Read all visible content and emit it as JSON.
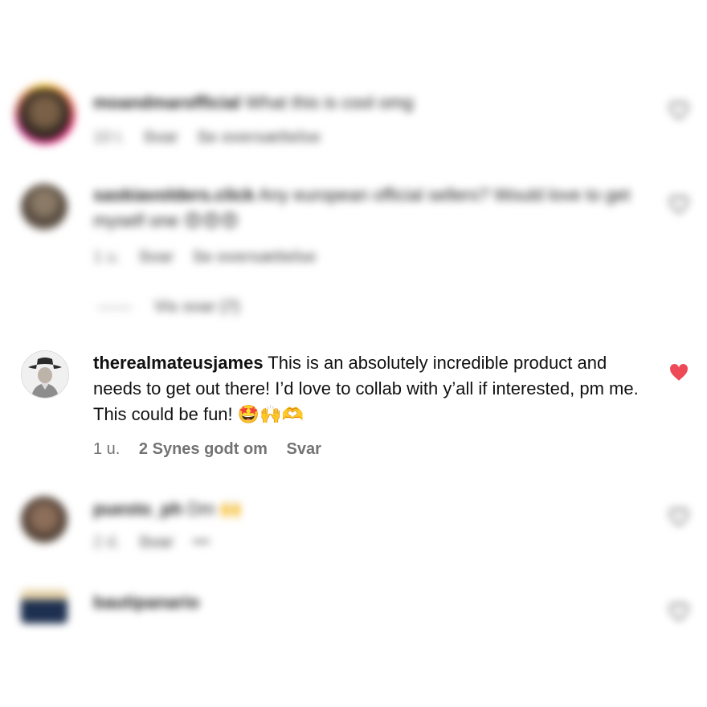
{
  "comments": [
    {
      "username": "moandmarofficial",
      "text": "What this is cool omg",
      "time": "10 t.",
      "reply": "Svar",
      "translate": "Se oversættelse",
      "liked": false
    },
    {
      "username": "saskiavolders.click",
      "text": "Any european official sellers? Would love to get myself one",
      "emoji": "😍😍😍",
      "time": "1 u.",
      "reply": "Svar",
      "translate": "Se oversættelse",
      "view_replies": "Vis svar (7)",
      "liked": false
    },
    {
      "username": "therealmateusjames",
      "text": "This is an absolutely incredible product and needs to get out there! I’d love to collab with y’all if interested, pm me. This could be fun!",
      "emoji": "🤩🙌🫶",
      "time": "1 u.",
      "likes": "2 Synes godt om",
      "reply": "Svar",
      "liked": true
    },
    {
      "username": "puesto_ph",
      "text": "Dm",
      "emoji": "🙌",
      "time": "2 d.",
      "reply": "Svar",
      "more": "•••",
      "liked": false
    },
    {
      "username": "bautipanario",
      "text": "",
      "liked": false
    }
  ],
  "colors": {
    "liked_heart": "#ed4956",
    "meta_text": "#737373",
    "story_ring": [
      "#f9ce34",
      "#ee2a7b",
      "#c13584"
    ]
  },
  "icons": [
    "heart-outline-icon",
    "heart-filled-icon"
  ]
}
